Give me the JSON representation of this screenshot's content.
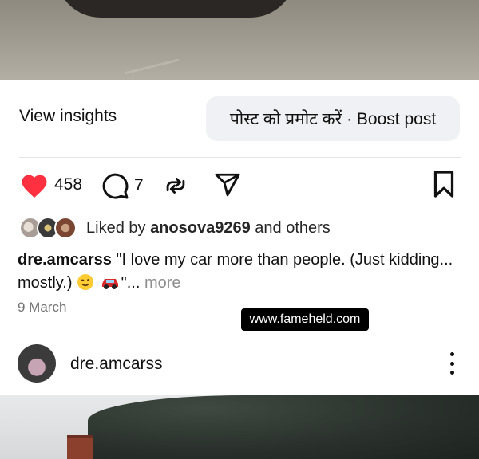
{
  "post_media": {
    "top_image": "car-photo",
    "bottom_image": "trees-photo"
  },
  "actions": {
    "view_insights": "View insights",
    "boost_post": "पोस्ट को प्रमोट करें · Boost post",
    "like_count": "458",
    "comment_count": "7",
    "icons": [
      "heart-icon",
      "comment-icon",
      "repost-icon",
      "share-icon",
      "bookmark-icon"
    ],
    "like_color": "#ff3040"
  },
  "likes": {
    "prefix": "Liked by",
    "user": "anosova9269",
    "suffix": "and others"
  },
  "caption": {
    "username": "dre.amcarss",
    "text_part1": "\"I love my car more than people. (Just kidding... mostly.)",
    "emoji1": "wink-emoji",
    "emoji2": "car-emoji",
    "text_part2": "\"...",
    "more": "more"
  },
  "date": "9 March",
  "watermark": "www.fameheld.com",
  "next_post": {
    "username": "dre.amcarss",
    "menu_icon": "more-vertical-icon"
  }
}
